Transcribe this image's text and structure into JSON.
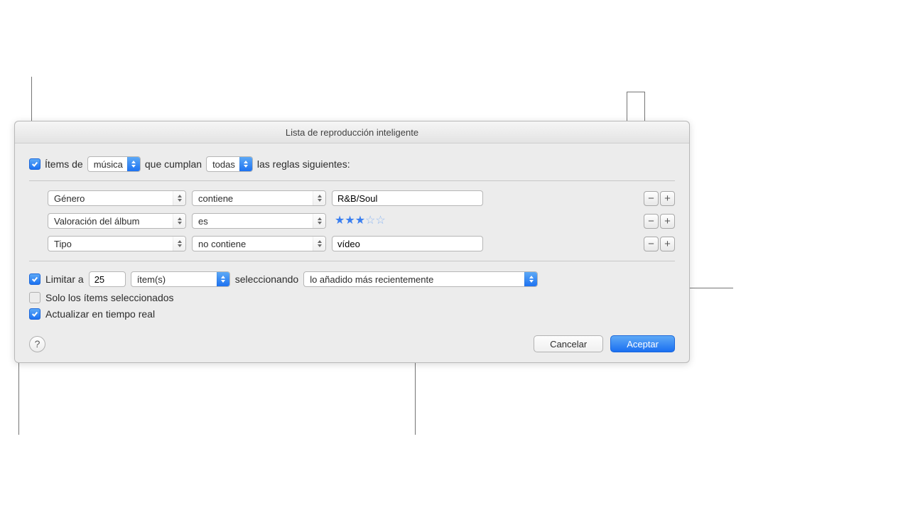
{
  "window": {
    "title": "Lista de reproducción inteligente"
  },
  "match": {
    "prefix": "Ítems de",
    "source": "música",
    "middle": "que cumplan",
    "scope": "todas",
    "suffix": "las reglas siguientes:"
  },
  "rules": [
    {
      "attr": "Género",
      "op": "contiene",
      "value": "R&B/Soul",
      "kind": "text"
    },
    {
      "attr": "Valoración del álbum",
      "op": "es",
      "stars": 3,
      "kind": "stars"
    },
    {
      "attr": "Tipo",
      "op": "no contiene",
      "value": "vídeo",
      "kind": "text"
    }
  ],
  "limit": {
    "label": "Limitar a",
    "value": "25",
    "unit": "ítem(s)",
    "by_label": "seleccionando",
    "by": "lo añadido más recientemente"
  },
  "onlySelected": {
    "label": "Solo los ítems seleccionados"
  },
  "liveUpdate": {
    "label": "Actualizar en tiempo real"
  },
  "buttons": {
    "help": "?",
    "cancel": "Cancelar",
    "ok": "Aceptar"
  }
}
